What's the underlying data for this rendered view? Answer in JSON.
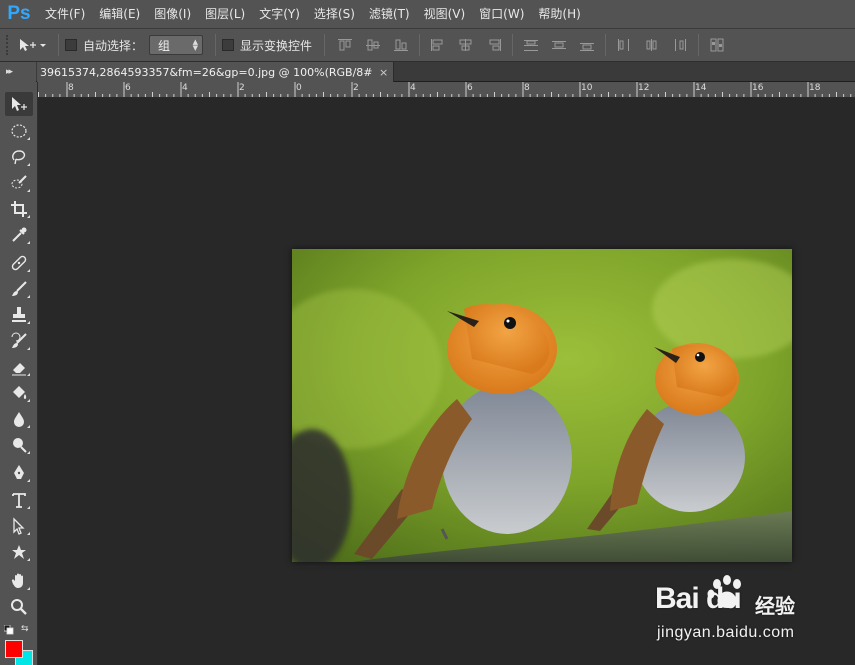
{
  "app": {
    "logo": "Ps"
  },
  "menu": [
    {
      "label": "文件(F)"
    },
    {
      "label": "编辑(E)"
    },
    {
      "label": "图像(I)"
    },
    {
      "label": "图层(L)"
    },
    {
      "label": "文字(Y)"
    },
    {
      "label": "选择(S)"
    },
    {
      "label": "滤镜(T)"
    },
    {
      "label": "视图(V)"
    },
    {
      "label": "窗口(W)"
    },
    {
      "label": "帮助(H)"
    }
  ],
  "options": {
    "auto_select_label": "自动选择：",
    "auto_select_checked": false,
    "auto_select_value": "组",
    "show_transform_label": "显示变换控件",
    "show_transform_checked": false
  },
  "document": {
    "tab_title": "39615374,2864593357&fm=26&gp=0.jpg @ 100%(RGB/8#)",
    "close_glyph": "×"
  },
  "ruler": {
    "labels": [
      "8",
      "6",
      "4",
      "2",
      "0",
      "2",
      "4",
      "6",
      "8",
      "10",
      "12",
      "14",
      "16",
      "18"
    ]
  },
  "toolbar": {
    "tools": [
      {
        "name": "move-tool-icon"
      },
      {
        "name": "elliptical-marquee-tool-icon"
      },
      {
        "name": "lasso-tool-icon"
      },
      {
        "name": "quick-selection-tool-icon"
      },
      {
        "name": "crop-tool-icon"
      },
      {
        "name": "eyedropper-tool-icon"
      },
      {
        "name": "healing-brush-tool-icon"
      },
      {
        "name": "brush-tool-icon"
      },
      {
        "name": "clone-stamp-tool-icon"
      },
      {
        "name": "history-brush-tool-icon"
      },
      {
        "name": "eraser-tool-icon"
      },
      {
        "name": "paint-bucket-tool-icon"
      },
      {
        "name": "blur-tool-icon"
      },
      {
        "name": "dodge-tool-icon"
      },
      {
        "name": "pen-tool-icon"
      },
      {
        "name": "type-tool-icon"
      },
      {
        "name": "path-selection-tool-icon"
      },
      {
        "name": "custom-shape-tool-icon"
      },
      {
        "name": "hand-tool-icon"
      },
      {
        "name": "zoom-tool-icon"
      }
    ],
    "foreground_color": "#ff0000",
    "background_color": "#00e5e5"
  },
  "watermark": {
    "brand": "Bai du",
    "brand_cn": "经验",
    "url": "jingyan.baidu.com"
  },
  "colors": {
    "ui_panel": "#535353",
    "canvas_bg": "#282828",
    "accent": "#31a8ff"
  }
}
